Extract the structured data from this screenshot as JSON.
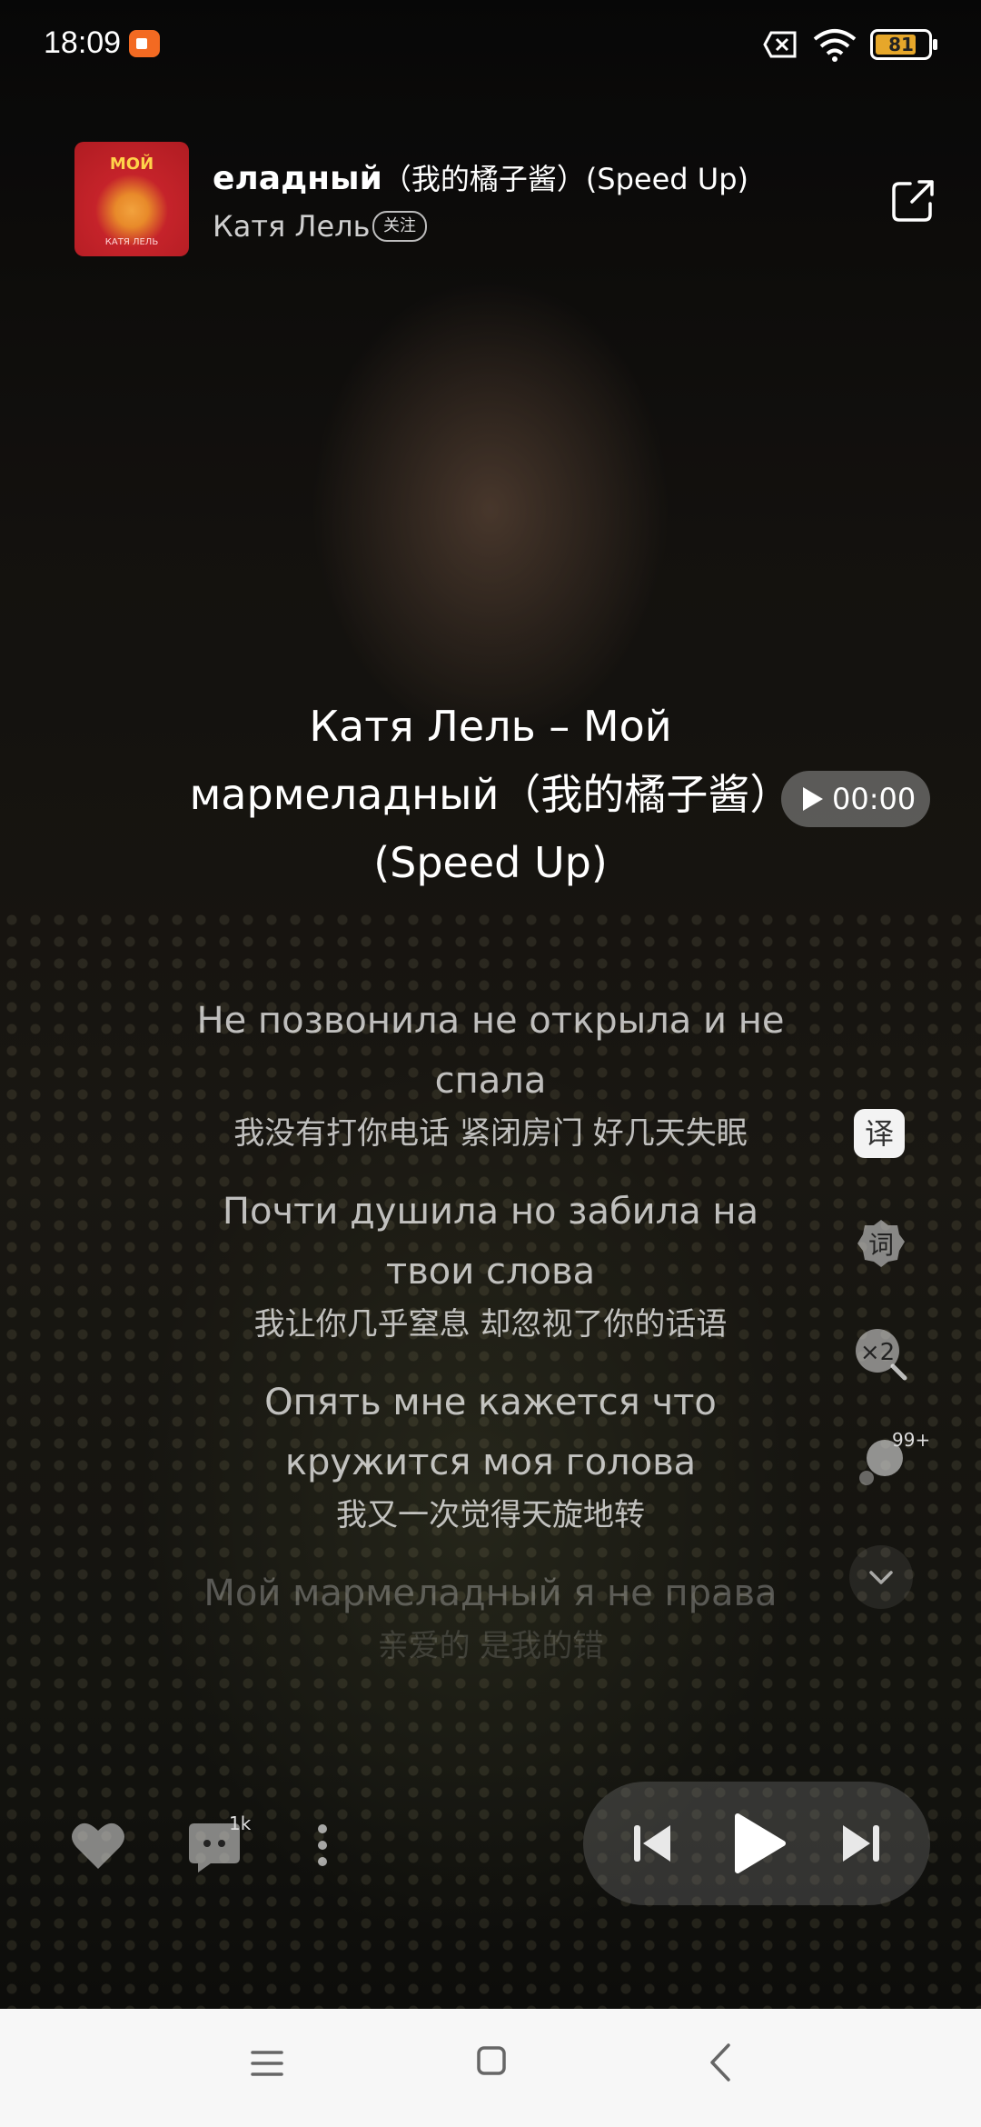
{
  "status_bar": {
    "time": "18:09",
    "battery": "81",
    "battery_level": 0.81
  },
  "header": {
    "cover_title": "МОЙ",
    "cover_artist": "КАТЯ ЛЕЛЬ",
    "song_title_main": "еладный",
    "song_title_sub": "（我的橘子酱）(Speed Up)",
    "artist": "Катя Лель",
    "follow_label": "关注"
  },
  "title_block": {
    "line1": "Катя Лель – Мой",
    "line2": "мармеладный（我的橘子酱）",
    "line3": "(Speed Up)",
    "time_label": "00:00"
  },
  "lyrics": [
    {
      "ru": "Не позвонила не открыла и не спала",
      "zh": "我没有打你电话 紧闭房门 好几天失眠"
    },
    {
      "ru": "Почти душила но забила на твои слова",
      "zh": "我让你几乎窒息 却忽视了你的话语"
    },
    {
      "ru": "Опять мне кажется что кружится моя голова",
      "zh": "我又一次觉得天旋地转"
    },
    {
      "ru": "Мой мармеладный я не права",
      "zh": "亲爱的 是我的错"
    }
  ],
  "tools": {
    "translate_label": "译",
    "words_label": "词",
    "speed_label": "×2",
    "tag_badge": "99+"
  },
  "actions": {
    "comment_count": "1k"
  },
  "colors": {
    "accent_battery": "#e6a72a",
    "record_badge": "#f36a22",
    "nav_bar": "#f7f7f7"
  }
}
